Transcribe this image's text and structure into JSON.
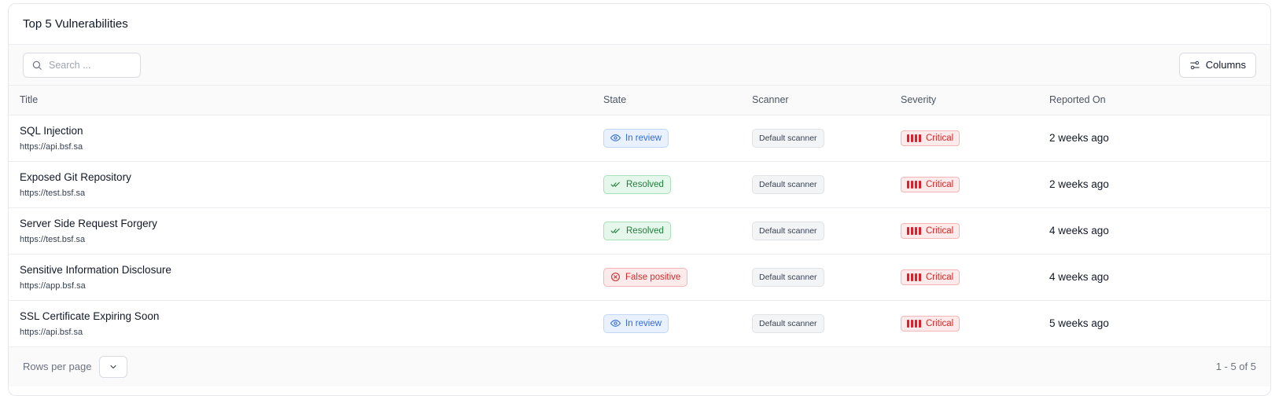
{
  "card": {
    "title": "Top 5 Vulnerabilities"
  },
  "toolbar": {
    "search_placeholder": "Search ...",
    "columns_label": "Columns"
  },
  "table": {
    "headers": [
      "Title",
      "State",
      "Scanner",
      "Severity",
      "Reported On"
    ],
    "rows": [
      {
        "title": "SQL Injection",
        "url": "https://api.bsf.sa",
        "state": "In review",
        "state_type": "review",
        "scanner": "Default scanner",
        "severity": "Critical",
        "reported": "2 weeks ago"
      },
      {
        "title": "Exposed Git Repository",
        "url": "https://test.bsf.sa",
        "state": "Resolved",
        "state_type": "resolved",
        "scanner": "Default scanner",
        "severity": "Critical",
        "reported": "2 weeks ago"
      },
      {
        "title": "Server Side Request Forgery",
        "url": "https://test.bsf.sa",
        "state": "Resolved",
        "state_type": "resolved",
        "scanner": "Default scanner",
        "severity": "Critical",
        "reported": "4 weeks ago"
      },
      {
        "title": "Sensitive Information Disclosure",
        "url": "https://app.bsf.sa",
        "state": "False positive",
        "state_type": "false",
        "scanner": "Default scanner",
        "severity": "Critical",
        "reported": "4 weeks ago"
      },
      {
        "title": "SSL Certificate Expiring Soon",
        "url": "https://api.bsf.sa",
        "state": "In review",
        "state_type": "review",
        "scanner": "Default scanner",
        "severity": "Critical",
        "reported": "5 weeks ago"
      }
    ]
  },
  "footer": {
    "rows_per_page_label": "Rows per page",
    "pagination": "1 - 5 of 5"
  },
  "icons": {
    "search": "search-icon",
    "columns": "sliders-icon",
    "in_review": "eye-icon",
    "resolved": "double-check-icon",
    "false_positive": "x-circle-icon",
    "severity": "severity-bars-icon",
    "rows_select": "chevron-down-icon"
  },
  "colors": {
    "review": "#2f6bd8",
    "resolved": "#1e7f3c",
    "false_positive": "#d12a2a",
    "critical": "#e11d2a"
  }
}
